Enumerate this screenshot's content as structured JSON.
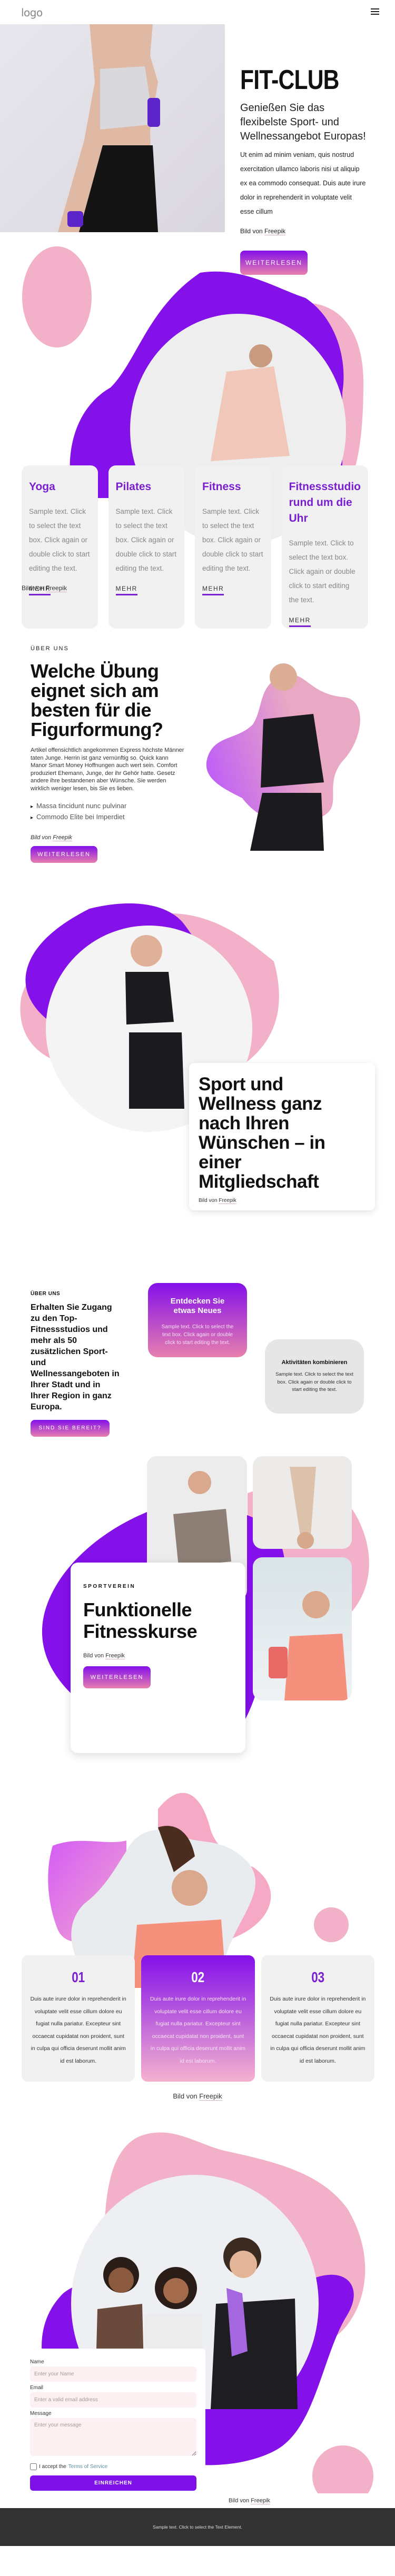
{
  "header": {
    "logo": "logo",
    "menu_icon": "hamburger-menu-icon"
  },
  "hero": {
    "title": "FIT-CLUB",
    "subtitle": "Genießen Sie das flexibelste Sport- und Wellnessangebot Europas!",
    "body": "Ut enim ad minim veniam, quis nostrud exercitation ullamco laboris nisi ut aliquip ex ea commodo consequat. Duis aute irure dolor in reprehenderit in voluptate velit esse cillum",
    "credit_prefix": "Bild von",
    "credit_link": "Freepik",
    "button": "Weiterlesen"
  },
  "classes": {
    "cards": [
      {
        "title": "Yoga",
        "text": "Sample text. Click to select the text box. Click again or double click to start editing the text.",
        "link": "MEHR"
      },
      {
        "title": "Pilates",
        "text": "Sample text. Click to select the text box. Click again or double click to start editing the text.",
        "link": "MEHR"
      },
      {
        "title": "Fitness",
        "text": "Sample text. Click to select the text box. Click again or double click to start editing the text.",
        "link": "MEHR"
      },
      {
        "title": "Fitnessstudio rund um die Uhr",
        "text": "Sample text. Click to select the text box. Click again or double click to start editing the text.",
        "link": "MEHR"
      }
    ],
    "credit_prefix": "Bild von",
    "credit_link": "Freepik"
  },
  "about": {
    "eyebrow": "ÜBER UNS",
    "title": "Welche Übung eignet sich am besten für die Figurformung?",
    "body": "Artikel offensichtlich angekommen Express höchste Männer taten Junge. Herrin ist ganz vernünftig so. Quick kann Manor Smart Money Hoffnungen auch wert sein. Comfort produziert Ehemann, Junge, der ihr Gehör hatte. Gesetz andere ihre bestandenen aber Wünsche. Sie werden wirklich weniger lesen, bis Sie es lieben.",
    "list": [
      "Massa tincidunt nunc pulvinar",
      "Commodo Elite bei Imperdiet"
    ],
    "credit_prefix": "Bild von",
    "credit_link": "Freepik",
    "button": "Weiterlesen"
  },
  "sport": {
    "title": "Sport und Wellness ganz nach Ihren Wünschen – in einer Mitgliedschaft",
    "credit_prefix": "Bild von",
    "credit_link": "Freepik"
  },
  "access": {
    "eyebrow": "ÜBER UNS",
    "title": "Erhalten Sie Zugang zu den Top-Fitnessstudios und mehr als 50 zusätzlichen Sport- und Wellnessangeboten in Ihrer Stadt und in Ihrer Region in ganz Europa.",
    "button": "Sind Sie bereit?",
    "discover": {
      "title": "Entdecken Sie etwas Neues",
      "text": "Sample text. Click to select the text box. Click again or double click to start editing the text."
    },
    "combine": {
      "title": "Aktivitäten kombinieren",
      "text": "Sample text. Click to select the text box. Click again or double click to start editing the text."
    }
  },
  "functional": {
    "eyebrow": "SPORTVEREIN",
    "title": "Funktionelle Fitnesskurse",
    "credit_prefix": "Bild von",
    "credit_link": "Freepik",
    "button": "Weiterlesen"
  },
  "steps": {
    "items": [
      {
        "num": "01",
        "text": "Duis aute irure dolor in reprehenderit in voluptate velit esse cillum dolore eu fugiat nulla pariatur. Excepteur sint occaecat cupidatat non proident, sunt in culpa qui officia deserunt mollit anim id est laborum."
      },
      {
        "num": "02",
        "text": "Duis aute irure dolor in reprehenderit in voluptate velit esse cillum dolore eu fugiat nulla pariatur. Excepteur sint occaecat cupidatat non proident, sunt in culpa qui officia deserunt mollit anim id est laborum."
      },
      {
        "num": "03",
        "text": "Duis aute irure dolor in reprehenderit in voluptate velit esse cillum dolore eu fugiat nulla pariatur. Excepteur sint occaecat cupidatat non proident, sunt in culpa qui officia deserunt mollit anim id est laborum."
      }
    ],
    "credit_prefix": "Bild von",
    "credit_link": "Freepik"
  },
  "contact": {
    "name_label": "Name",
    "name_placeholder": "Enter your Name",
    "email_label": "Email",
    "email_placeholder": "Enter a valid email address",
    "message_label": "Message",
    "message_placeholder": "Enter your message",
    "terms_prefix": "I accept the",
    "terms_link": "Terms of Service",
    "submit": "EINREICHEN",
    "credit_prefix": "Bild von",
    "credit_link": "Freepik"
  },
  "footer": {
    "text": "Sample text. Click to select the Text Element."
  },
  "colors": {
    "purple": "#8410ea",
    "pink": "#f2b1c8",
    "accent_text": "#7a1fd0",
    "footer_bg": "#333333"
  }
}
